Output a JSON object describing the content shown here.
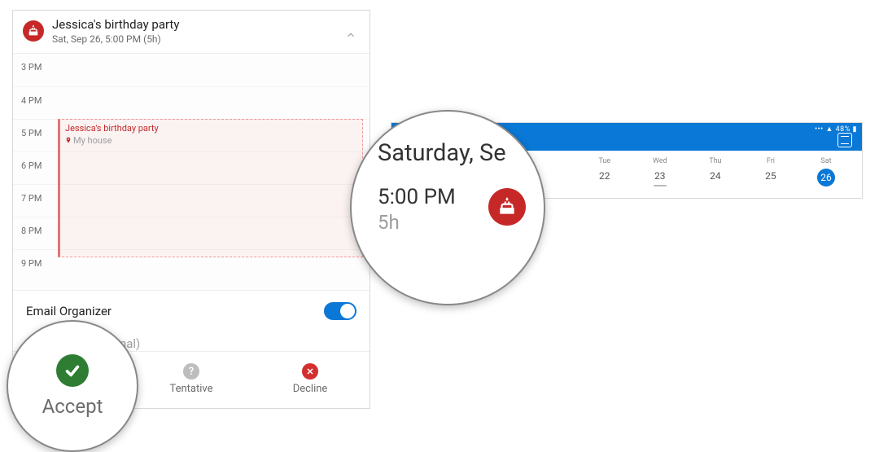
{
  "invite": {
    "title": "Jessica's birthday party",
    "subtitle": "Sat, Sep 26, 5:00 PM (5h)",
    "organizer_label": "Email Organizer",
    "note_placeholder": "Add a note (optional)",
    "hours": [
      "3 PM",
      "4 PM",
      "5 PM",
      "6 PM",
      "7 PM",
      "8 PM",
      "9 PM"
    ],
    "event": {
      "title": "Jessica's birthday party",
      "location": "My house"
    },
    "rsvp": {
      "accept": "Accept",
      "tentative": "Tentative",
      "decline": "Decline"
    }
  },
  "magnifier_accept": {
    "label": "Accept"
  },
  "magnifier_detail": {
    "day_line": "Saturday, Se",
    "time": "5:00 PM",
    "duration": "5h"
  },
  "week": {
    "battery": "48%",
    "days": [
      {
        "lbl": "Tue",
        "num": "22"
      },
      {
        "lbl": "Wed",
        "num": "23"
      },
      {
        "lbl": "Thu",
        "num": "24"
      },
      {
        "lbl": "Fri",
        "num": "25"
      },
      {
        "lbl": "Sat",
        "num": "26"
      }
    ],
    "selected_index": 4,
    "today_index": 1
  }
}
